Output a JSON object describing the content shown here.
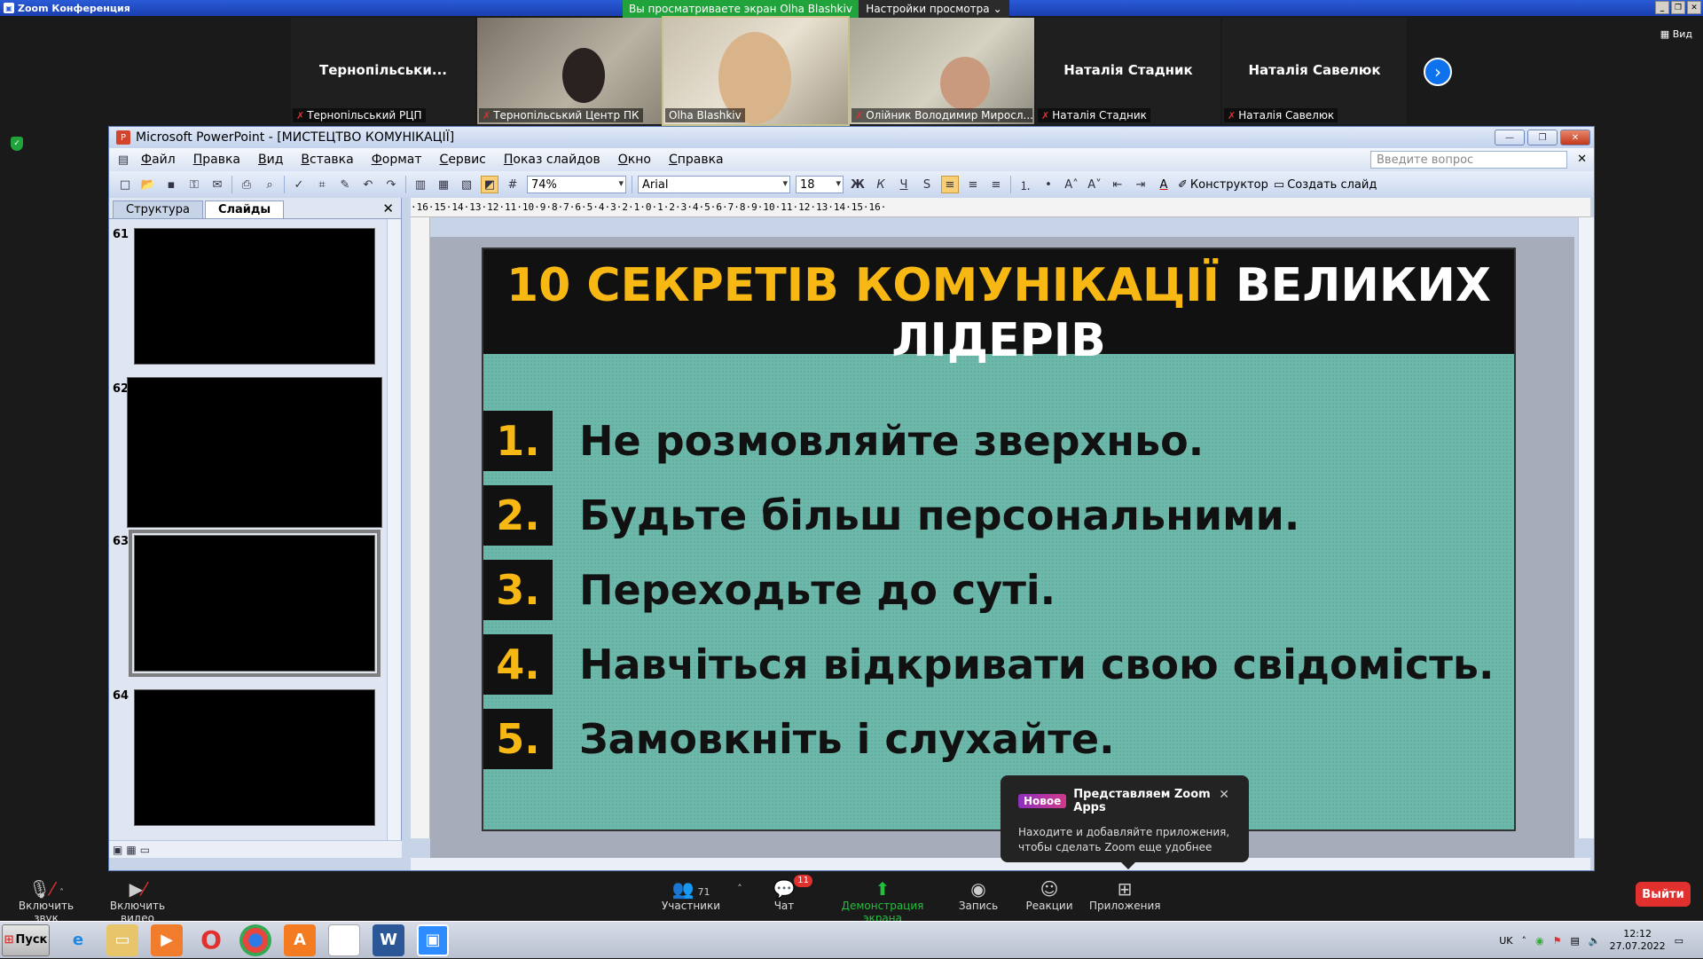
{
  "zoom": {
    "window_title": "Zoom Конференция",
    "share_banner": "Вы просматриваете экран Olha Blashkiv",
    "view_settings": "Настройки просмотра",
    "view_button": "Вид",
    "participants": [
      {
        "big_name": "Тернопільськи...",
        "label": "Тернопільський РЦП",
        "video": false
      },
      {
        "big_name": "",
        "label": "Тернопільський Центр ПК",
        "video": true
      },
      {
        "big_name": "",
        "label": "Olha Blashkiv",
        "video": true
      },
      {
        "big_name": "",
        "label": "Олійник Володимир Миросл...",
        "video": true
      },
      {
        "big_name": "Наталія Стадник",
        "label": "Наталія Стадник",
        "video": false
      },
      {
        "big_name": "Наталія Савелюк",
        "label": "Наталія Савелюк",
        "video": false
      }
    ],
    "controls": {
      "mute": "Включить звук",
      "video": "Включить видео",
      "participants": "Участники",
      "participants_count": "71",
      "chat": "Чат",
      "chat_badge": "11",
      "share": "Демонстрация экрана",
      "record": "Запись",
      "reactions": "Реакции",
      "apps": "Приложения",
      "leave": "Выйти"
    },
    "toast": {
      "badge": "Новое",
      "title": "Представляем Zoom Apps",
      "body": "Находите и добавляйте приложения, чтобы сделать Zoom еще удобнее"
    }
  },
  "ppt": {
    "title": "Microsoft PowerPoint - [МИСТЕЦТВО КОМУНІКАЦІЇ]",
    "menu": [
      "Файл",
      "Правка",
      "Вид",
      "Вставка",
      "Формат",
      "Сервис",
      "Показ слайдов",
      "Окно",
      "Справка"
    ],
    "help_placeholder": "Введите вопрос",
    "zoom_level": "74%",
    "font": "Arial",
    "font_size": "18",
    "design_label": "Конструктор",
    "new_slide_label": "Создать слайд",
    "tabs": [
      "Структура",
      "Слайды"
    ],
    "thumbnails": [
      "61",
      "62",
      "63",
      "64"
    ],
    "ruler": "·16·15·14·13·12·11·10·9·8·7·6·5·4·3·2·1·0·1·2·3·4·5·6·7·8·9·10·11·12·13·14·15·16·",
    "slide": {
      "title_yellow": "10 СЕКРЕТІВ КОМУНІКАЦІЇ",
      "title_white_1": "ВЕЛИКИХ",
      "title_white_2": "ЛІДЕРІВ",
      "items": [
        {
          "num": "1.",
          "text": "Не розмовляйте зверхньо."
        },
        {
          "num": "2.",
          "text": "Будьте більш персональними."
        },
        {
          "num": "3.",
          "text": "Переходьте до суті."
        },
        {
          "num": "4.",
          "text": "Навчіться відкривати свою свідомість."
        },
        {
          "num": "5.",
          "text": "Замовкніть і слухайте."
        }
      ]
    }
  },
  "taskbar": {
    "start": "Пуск",
    "lang": "UK",
    "time": "12:12",
    "date": "27.07.2022"
  }
}
